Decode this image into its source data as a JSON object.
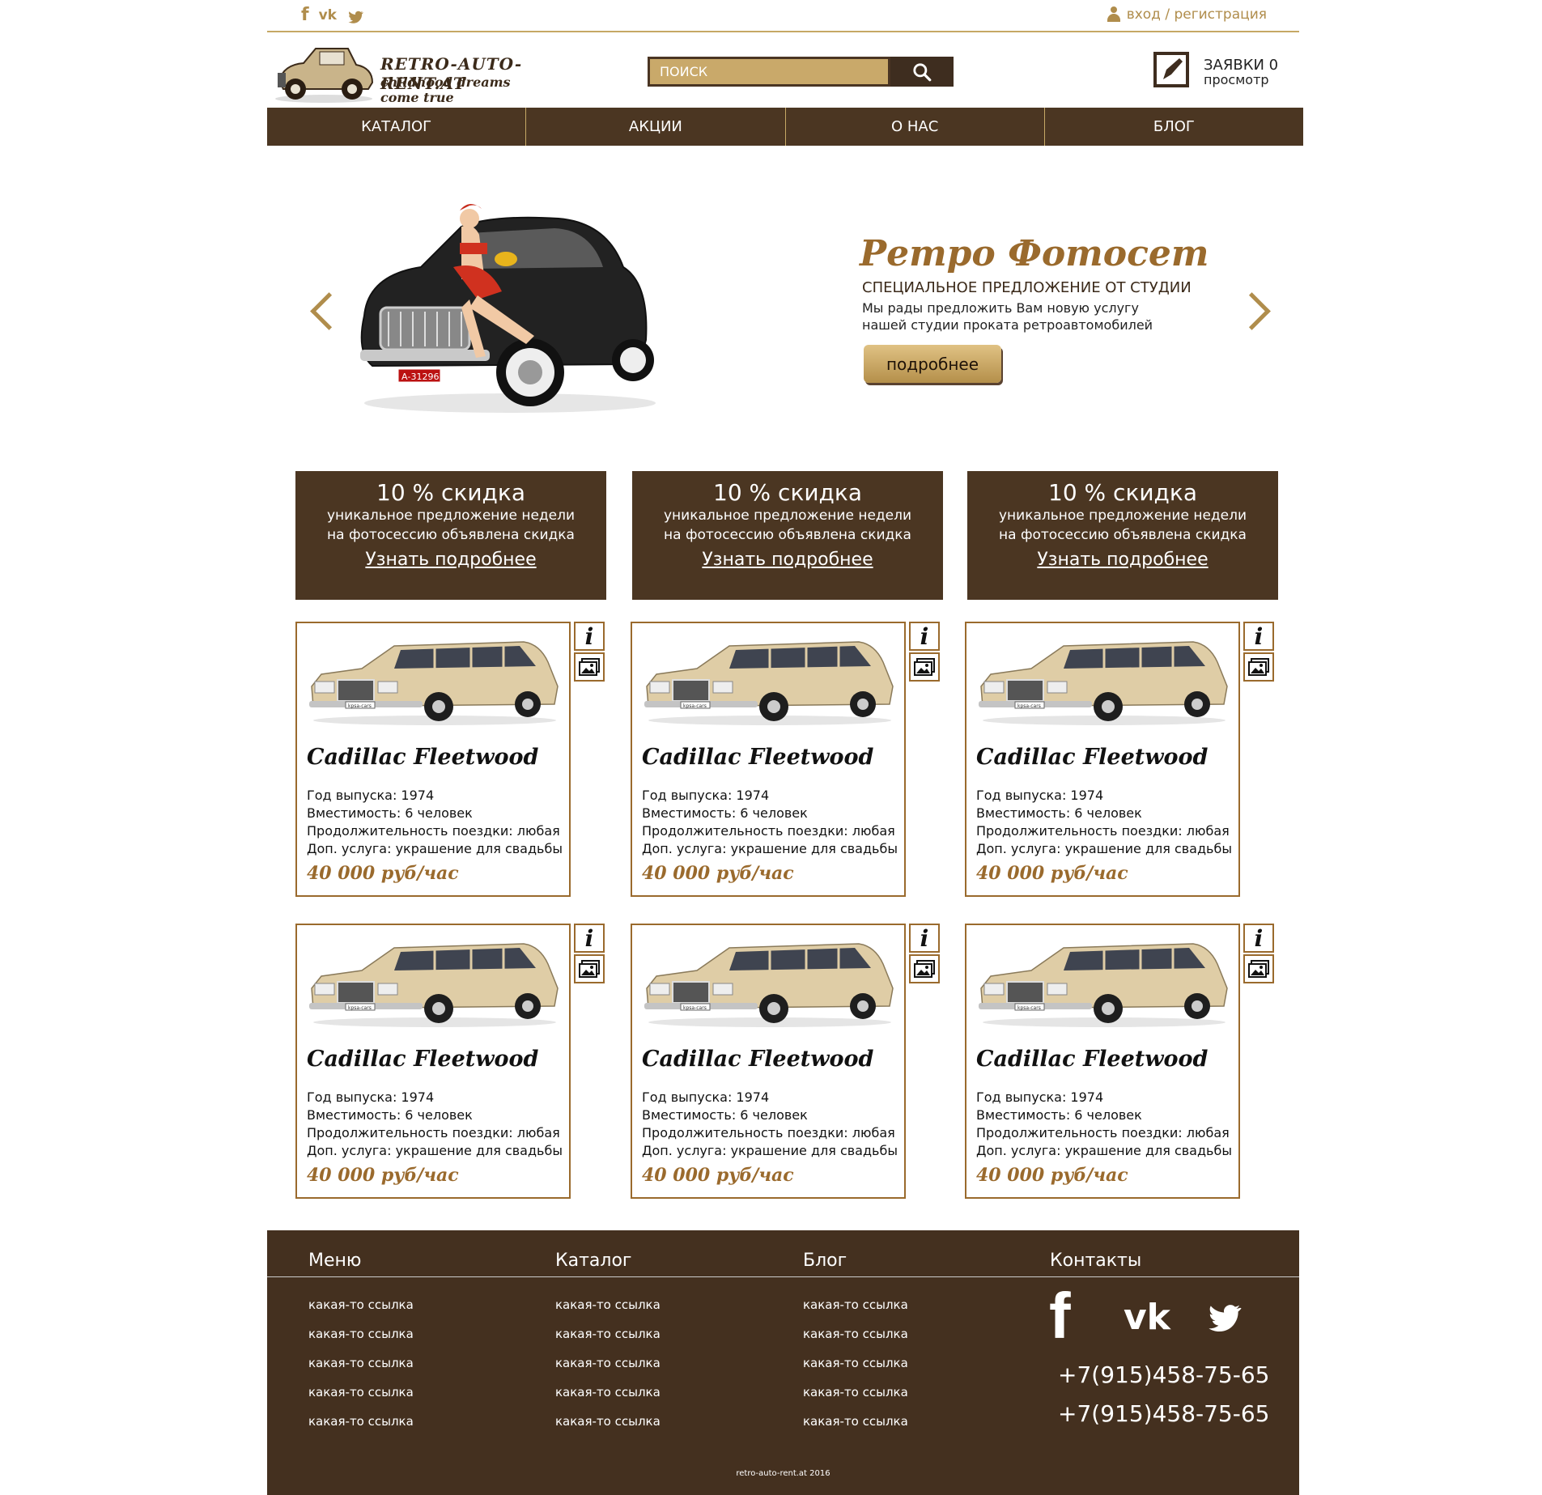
{
  "top": {
    "social": [
      "f",
      "vk",
      "twitter"
    ],
    "login": "вход / регистрация"
  },
  "logo": {
    "title": "RETRO-AUTO-RENT.AT",
    "subtitle": "childhood dreams come true"
  },
  "search": {
    "placeholder": "ПОИСК"
  },
  "cart": {
    "line1": "ЗАЯВКИ 0",
    "line2": "просмотр"
  },
  "nav": [
    "КАТАЛОГ",
    "АКЦИИ",
    "О НАС",
    "БЛОГ"
  ],
  "hero": {
    "title": "Ретро Фотосет",
    "subtitle": "СПЕЦИАЛЬНОЕ ПРЕДЛОЖЕНИЕ ОТ СТУДИИ",
    "description": "Мы рады предложить Вам новую услугу нашей студии проката ретроавтомобилей",
    "button": "подробнее",
    "plate": "А-31296"
  },
  "promos": [
    {
      "title": "10 % скидка",
      "line1": "уникальное предложение недели",
      "line2": "на фотосессию объявлена скидка",
      "link": "Узнать подробнее"
    },
    {
      "title": "10 % скидка",
      "line1": "уникальное предложение недели",
      "line2": "на фотосессию объявлена скидка",
      "link": "Узнать подробнее"
    },
    {
      "title": "10 % скидка",
      "line1": "уникальное предложение недели",
      "line2": "на фотосессию объявлена скидка",
      "link": "Узнать подробнее"
    }
  ],
  "cards": [
    {
      "name": "Cadillac Fleetwood",
      "year": "Год выпуска: 1974",
      "capacity": "Вместимость: 6 человек",
      "duration": "Продолжительность поездки: любая",
      "extra": "Доп. услуга: украшение для свадьбы",
      "price": "40 000 руб/час",
      "plate": "kpsa-cars"
    },
    {
      "name": "Cadillac Fleetwood",
      "year": "Год выпуска: 1974",
      "capacity": "Вместимость: 6 человек",
      "duration": "Продолжительность поездки: любая",
      "extra": "Доп. услуга: украшение для свадьбы",
      "price": "40 000 руб/час",
      "plate": "kpsa-cars"
    },
    {
      "name": "Cadillac Fleetwood",
      "year": "Год выпуска: 1974",
      "capacity": "Вместимость: 6 человек",
      "duration": "Продолжительность поездки: любая",
      "extra": "Доп. услуга: украшение для свадьбы",
      "price": "40 000 руб/час",
      "plate": "kpsa-cars"
    },
    {
      "name": "Cadillac Fleetwood",
      "year": "Год выпуска: 1974",
      "capacity": "Вместимость: 6 человек",
      "duration": "Продолжительность поездки: любая",
      "extra": "Доп. услуга: украшение для свадьбы",
      "price": "40 000 руб/час",
      "plate": "kpsa-cars"
    },
    {
      "name": "Cadillac Fleetwood",
      "year": "Год выпуска: 1974",
      "capacity": "Вместимость: 6 человек",
      "duration": "Продолжительность поездки: любая",
      "extra": "Доп. услуга: украшение для свадьбы",
      "price": "40 000 руб/час",
      "plate": "kpsa-cars"
    },
    {
      "name": "Cadillac Fleetwood",
      "year": "Год выпуска: 1974",
      "capacity": "Вместимость: 6 человек",
      "duration": "Продолжительность поездки: любая",
      "extra": "Доп. услуга: украшение для свадьбы",
      "price": "40 000 руб/час",
      "plate": "kpsa-cars"
    }
  ],
  "footer": {
    "columns": [
      {
        "title": "Меню",
        "links": [
          "какая-то ссылка",
          "какая-то ссылка",
          "какая-то ссылка",
          "какая-то ссылка",
          "какая-то ссылка"
        ]
      },
      {
        "title": "Каталог",
        "links": [
          "какая-то ссылка",
          "какая-то ссылка",
          "какая-то ссылка",
          "какая-то ссылка",
          "какая-то ссылка"
        ]
      },
      {
        "title": "Блог",
        "links": [
          "какая-то ссылка",
          "какая-то ссылка",
          "какая-то ссылка",
          "какая-то ссылка",
          "какая-то ссылка"
        ]
      }
    ],
    "contacts_title": "Контакты",
    "phones": [
      "+7(915)458-75-65",
      "+7(915)458-75-65"
    ],
    "copyright": "retro-auto-rent.at 2016"
  },
  "colors": {
    "brown": "#4b3622",
    "footer_brown": "#44301f",
    "gold": "#c9a96a",
    "accent": "#9a6a2d"
  }
}
